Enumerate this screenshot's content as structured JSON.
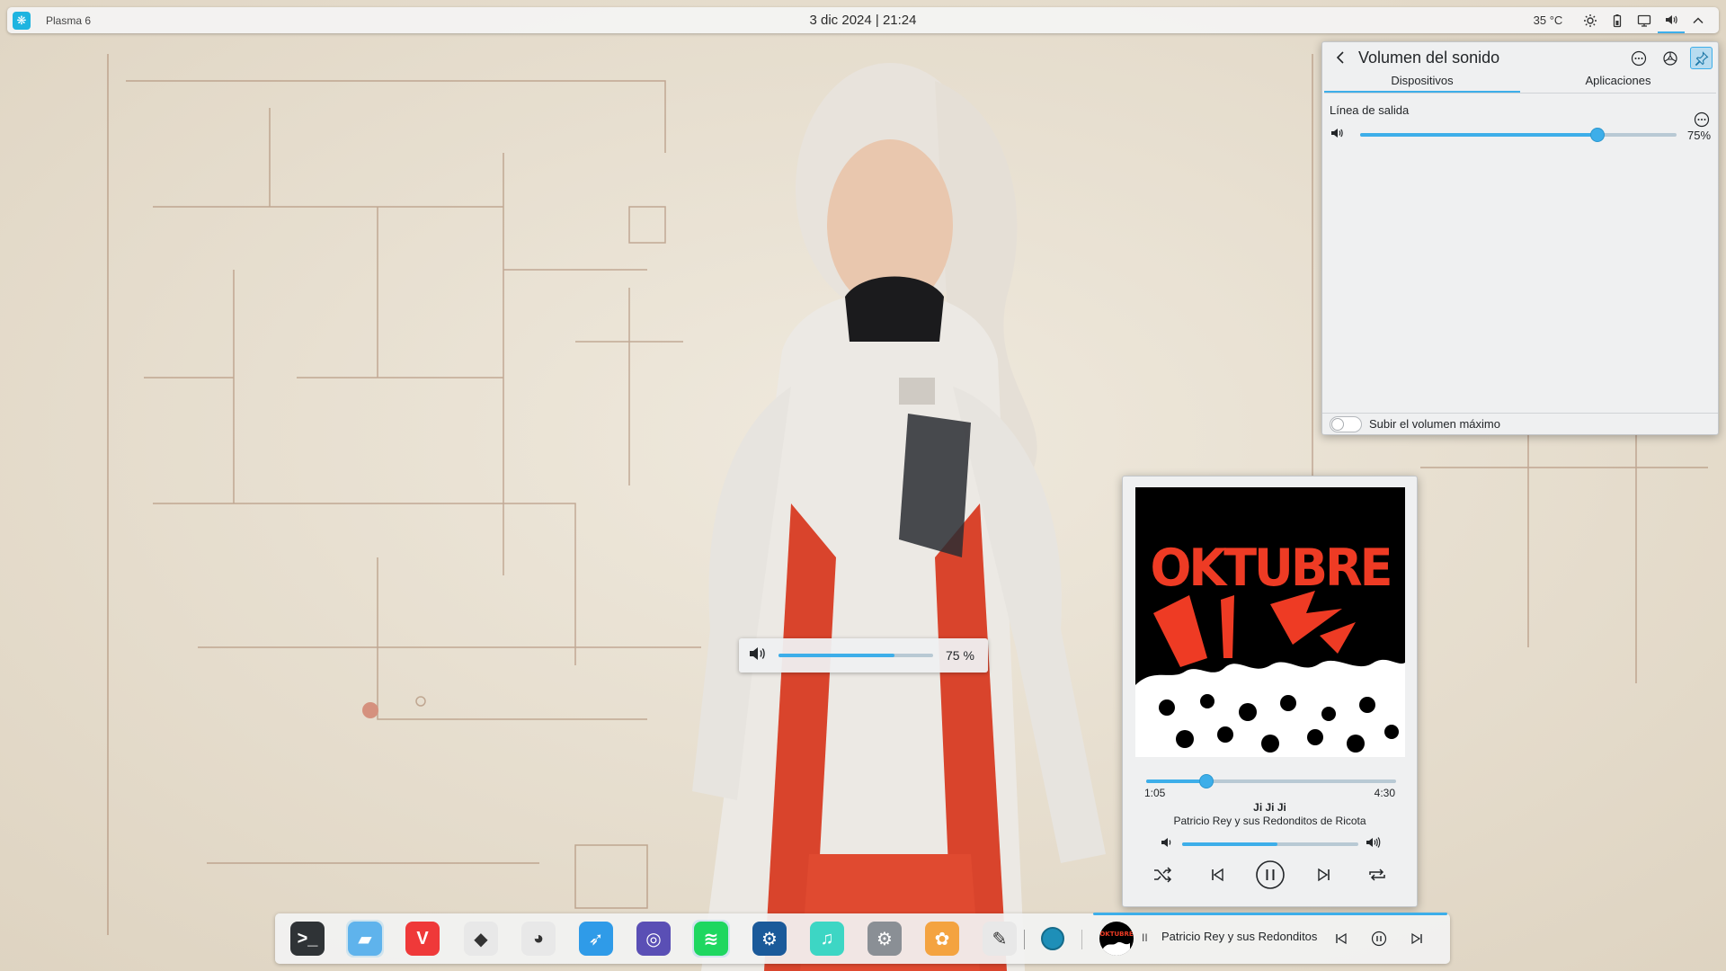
{
  "top_panel": {
    "title": "Plasma 6",
    "clock": "3 dic 2024 | 21:24",
    "tray": {
      "temperature": "35 °C",
      "icons": [
        "brightness-icon",
        "battery-icon",
        "display-icon",
        "volume-icon",
        "chevron-up-icon"
      ]
    }
  },
  "volume_popup": {
    "title": "Volumen del sonido",
    "tabs": [
      {
        "label": "Dispositivos",
        "active": true
      },
      {
        "label": "Aplicaciones",
        "active": false
      }
    ],
    "device": {
      "name": "Línea de salida",
      "volume_percent": 75,
      "volume_label": "75%"
    },
    "footer_toggle": {
      "label": "Subir el volumen máximo",
      "on": false
    },
    "accent": "#3daee9"
  },
  "osd": {
    "volume_percent": 75,
    "label": "75 %"
  },
  "media_player": {
    "album_art_text": "OKTUBRE",
    "elapsed": "1:05",
    "total": "4:30",
    "progress_fraction": 0.241,
    "track_title": "Ji Ji Ji",
    "artist": "Patricio Rey y sus Redonditos de Ricota",
    "volume_fraction": 0.54
  },
  "dock": {
    "apps": [
      {
        "name": "terminal",
        "glyph": ">_",
        "color": "#2f3336",
        "running": false
      },
      {
        "name": "files",
        "glyph": "▰",
        "color": "#5fb3ec",
        "running": true
      },
      {
        "name": "vivaldi",
        "glyph": "V",
        "color": "#ef3939",
        "running": false
      },
      {
        "name": "inkscape",
        "glyph": "◆",
        "color": "#e8e8e8",
        "running": false
      },
      {
        "name": "gimp",
        "glyph": "◕",
        "color": "#e8e8e8",
        "running": false
      },
      {
        "name": "swift",
        "glyph": "➶",
        "color": "#2f9be8",
        "running": false
      },
      {
        "name": "podcast",
        "glyph": "◎",
        "color": "#5a4fb5",
        "running": false
      },
      {
        "name": "spotify",
        "glyph": "≋",
        "color": "#1ed760",
        "running": true
      },
      {
        "name": "steam",
        "glyph": "⚙",
        "color": "#1b5a9a",
        "running": false
      },
      {
        "name": "music",
        "glyph": "♫",
        "color": "#3dd6c4",
        "running": false
      },
      {
        "name": "settings",
        "glyph": "⚙",
        "color": "#8a8f95",
        "running": false
      },
      {
        "name": "photos",
        "glyph": "✿",
        "color": "#f4a340",
        "running": false
      },
      {
        "name": "color-picker",
        "glyph": "✎",
        "color": "#e8e8e8",
        "running": false
      }
    ],
    "media": {
      "state": "II",
      "text": "Patricio Rey y sus Redonditos de Ricota"
    }
  }
}
